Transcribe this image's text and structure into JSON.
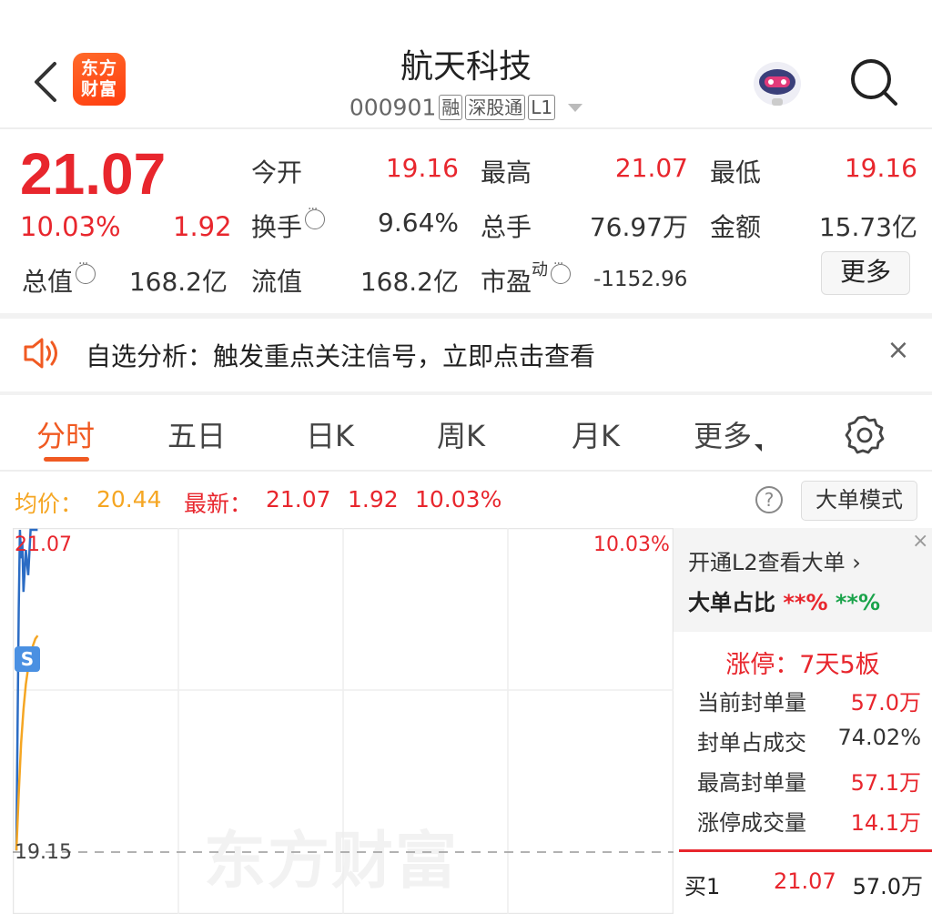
{
  "header": {
    "logo_text": "东方财富",
    "title": "航天科技",
    "code": "000901",
    "tags": [
      "融",
      "深股通",
      "L1"
    ]
  },
  "quote": {
    "price": "21.07",
    "change_pct": "10.03%",
    "change": "1.92",
    "fields": {
      "open_label": "今开",
      "open": "19.16",
      "high_label": "最高",
      "high": "21.07",
      "low_label": "最低",
      "low": "19.16",
      "turnover_label": "换手",
      "turnover": "9.64%",
      "volume_label": "总手",
      "volume": "76.97万",
      "amount_label": "金额",
      "amount": "15.73亿",
      "mktcap_label": "总值",
      "mktcap": "168.2亿",
      "float_label": "流值",
      "float": "168.2亿",
      "pe_label": "市盈",
      "pe_sup": "动",
      "pe": "-1152.96"
    },
    "more_label": "更多"
  },
  "notice": {
    "text": "自选分析：触发重点关注信号，立即点击查看",
    "close": "×"
  },
  "tabs": [
    "分时",
    "五日",
    "日K",
    "周K",
    "月K",
    "更多"
  ],
  "chart_head": {
    "avg_label": "均价：",
    "avg": "20.44",
    "latest_label": "最新：",
    "latest": "21.07",
    "latest_chg": "1.92",
    "latest_pct": "10.03%",
    "help": "?",
    "big_mode": "大单模式"
  },
  "chart": {
    "top_price": "21.07",
    "top_pct": "10.03%",
    "prev_close": "19.15",
    "watermark": "东方财富",
    "s_mark": "S"
  },
  "chart_data": {
    "type": "line",
    "prev_close": 19.15,
    "limit_up": 21.07,
    "series": [
      {
        "x": [
          0,
          0.5,
          1,
          1.5,
          2,
          2.5,
          3,
          4,
          5,
          6,
          7,
          8,
          9
        ],
        "values": [
          19.16,
          19.9,
          20.6,
          21.07,
          20.9,
          21.0,
          20.7,
          20.95,
          20.8,
          21.07,
          21.07,
          21.07,
          21.07
        ]
      },
      {
        "x": [
          0,
          1,
          2,
          3,
          4,
          5,
          6,
          7,
          8,
          9
        ],
        "values": [
          19.16,
          19.5,
          19.8,
          20.0,
          20.15,
          20.25,
          20.32,
          20.38,
          20.42,
          20.44
        ]
      }
    ]
  },
  "right_panel": {
    "l2_text": "开通L2查看大单",
    "l2_arrow": "›",
    "close": "×",
    "ratio_label": "大单占比",
    "ratio_red": "**%",
    "ratio_green": "**%",
    "limit_title": "涨停：7天5板",
    "rows": [
      {
        "k": "当前封单量",
        "v": "57.0万"
      },
      {
        "k": "封单占成交",
        "v": "74.02%"
      },
      {
        "k": "最高封单量",
        "v": "57.1万"
      },
      {
        "k": "涨停成交量",
        "v": "14.1万"
      }
    ],
    "buy1": {
      "label": "买1",
      "price": "21.07",
      "vol": "57.0万"
    }
  },
  "colors": {
    "up": "#e8262d",
    "accent": "#f05a22",
    "avg_line": "#f5a623",
    "price_line": "#2b6cc4",
    "down": "#1aa34a"
  }
}
